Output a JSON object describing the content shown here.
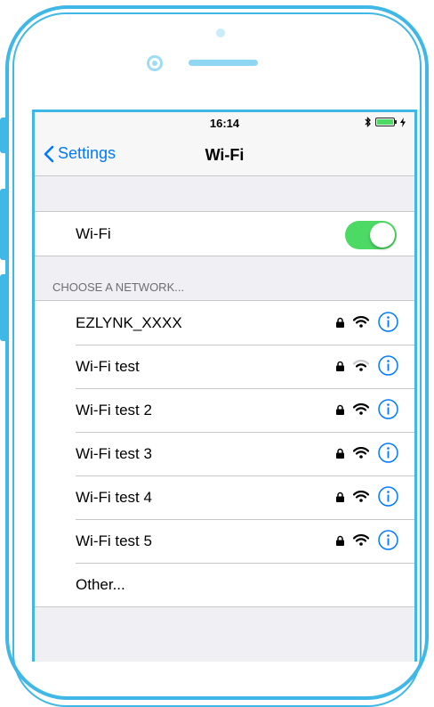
{
  "status_bar": {
    "time": "16:14",
    "bluetooth_icon": "bluetooth-icon",
    "battery_icon": "battery-icon",
    "charging_icon": "charging-bolt-icon"
  },
  "nav": {
    "back_label": "Settings",
    "title": "Wi-Fi"
  },
  "wifi_toggle": {
    "label": "Wi-Fi",
    "on": true
  },
  "networks_header": "CHOOSE A NETWORK...",
  "networks": [
    {
      "name": "EZLYNK_XXXX",
      "locked": true,
      "signal": "full"
    },
    {
      "name": "Wi-Fi test",
      "locked": true,
      "signal": "weak"
    },
    {
      "name": "Wi-Fi test 2",
      "locked": true,
      "signal": "full"
    },
    {
      "name": "Wi-Fi test 3",
      "locked": true,
      "signal": "full"
    },
    {
      "name": "Wi-Fi test 4",
      "locked": true,
      "signal": "full"
    },
    {
      "name": "Wi-Fi test 5",
      "locked": true,
      "signal": "full"
    }
  ],
  "other_label": "Other...",
  "colors": {
    "accent": "#007aff",
    "toggle_on": "#4cd964",
    "device_frame": "#3fb8e8"
  }
}
